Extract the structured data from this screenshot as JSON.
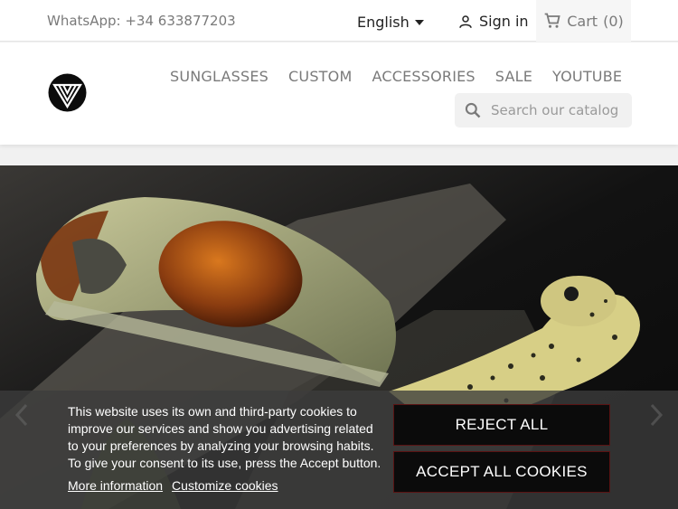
{
  "topbar": {
    "whatsapp": "WhatsApp: +34 633877203",
    "language": "English",
    "signin": "Sign in",
    "cart": "Cart",
    "cart_count": "(0)"
  },
  "nav": [
    "SUNGLASSES",
    "CUSTOM",
    "ACCESSORIES",
    "SALE",
    "YOUTUBE"
  ],
  "search": {
    "placeholder": "Search our catalog"
  },
  "cookie": {
    "text": "This website uses its own and third-party cookies to improve our services and show you advertising related to your preferences by analyzing your browsing habits. To give your consent to its use, press the Accept button.",
    "more_info": "More information",
    "customize": "Customize cookies",
    "reject": "REJECT ALL",
    "accept": "ACCEPT ALL COOKIES"
  },
  "colors": {
    "cookie_button_bg": "#0b0b0b",
    "cookie_button_border": "#5a1313"
  },
  "icons": [
    "user-icon",
    "cart-icon",
    "search-icon",
    "chevron-left-icon",
    "chevron-right-icon",
    "brand-logo"
  ]
}
